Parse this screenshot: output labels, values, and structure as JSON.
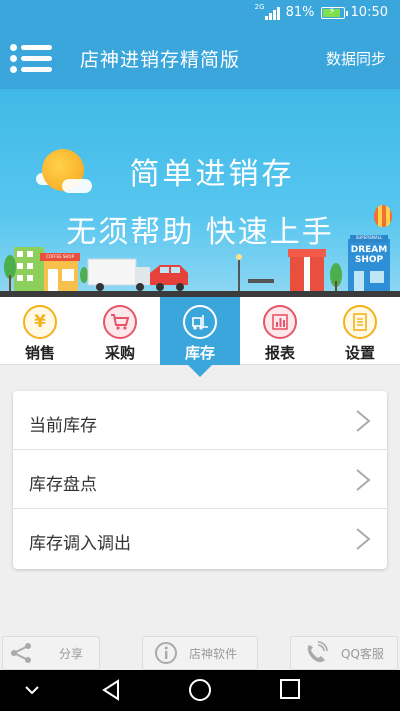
{
  "status_bar": {
    "network": "2G",
    "battery": "81%",
    "time": "10:50",
    "battery_level": 0.81
  },
  "header": {
    "title": "店神进销存精简版",
    "sync_label": "数据同步"
  },
  "banner": {
    "headline": "简单进销存",
    "tagline": "无须帮助  快速上手",
    "shop_sign": "DREAM\nSHOP",
    "shop_top": "SUPERSMALL",
    "small_shop_sign": "COFFEE SHOP"
  },
  "tabs": [
    {
      "label": "销售",
      "icon": "yen-icon"
    },
    {
      "label": "采购",
      "icon": "cart-icon"
    },
    {
      "label": "库存",
      "icon": "forklift-icon",
      "active": true
    },
    {
      "label": "报表",
      "icon": "bar-chart-icon"
    },
    {
      "label": "设置",
      "icon": "document-icon"
    }
  ],
  "menu_items": [
    {
      "label": "当前库存"
    },
    {
      "label": "库存盘点"
    },
    {
      "label": "库存调入调出"
    }
  ],
  "bottom_buttons": [
    {
      "label": "分享",
      "icon": "share-icon"
    },
    {
      "label": "店神软件",
      "icon": "info-icon"
    },
    {
      "label": "QQ客服",
      "icon": "phone-icon"
    }
  ],
  "colors": {
    "accent": "#3aa6dc",
    "yen": "#f2b21b",
    "cart": "#e8556b",
    "chart": "#e8556b",
    "settings": "#f2b21b"
  }
}
